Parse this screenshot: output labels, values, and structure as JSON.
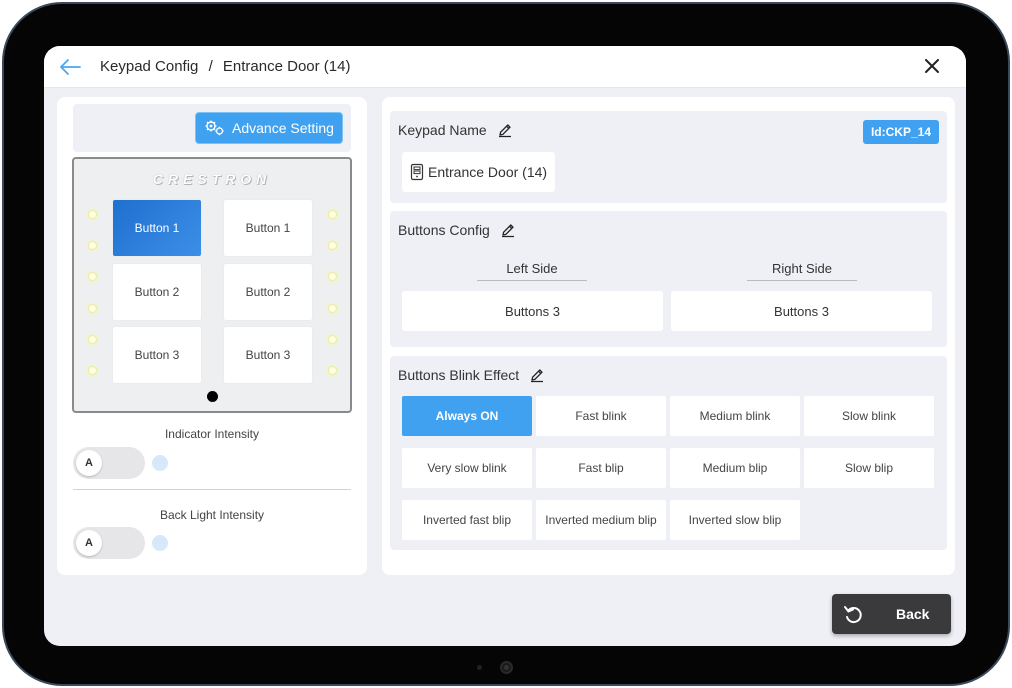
{
  "header": {
    "breadcrumb_parent": "Keypad Config",
    "breadcrumb_sep": "/",
    "breadcrumb_current": "Entrance Door (14)"
  },
  "left": {
    "advance_setting_label": "Advance Setting",
    "brand": "CRESTRON",
    "buttons": [
      {
        "label": "Button  1"
      },
      {
        "label": "Button  1"
      },
      {
        "label": "Button  2"
      },
      {
        "label": "Button  2"
      },
      {
        "label": "Button  3"
      },
      {
        "label": "Button  3"
      }
    ],
    "indicator_intensity_label": "Indicator Intensity",
    "indicator_toggle": "A",
    "backlight_intensity_label": "Back Light Intensity",
    "backlight_toggle": "A"
  },
  "keypad_name": {
    "title": "Keypad Name",
    "id_badge": "Id:CKP_14",
    "value": "Entrance Door (14)"
  },
  "buttons_config": {
    "title": "Buttons Config",
    "left_side_label": "Left Side",
    "left_side_value": "Buttons 3",
    "right_side_label": "Right Side",
    "right_side_value": "Buttons 3"
  },
  "blink_effect": {
    "title": "Buttons Blink Effect",
    "selected": "Always ON",
    "options": [
      "Always ON",
      "Fast blink",
      "Medium blink",
      "Slow blink",
      "Very slow blink",
      "Fast blip",
      "Medium blip",
      "Slow blip",
      "Inverted fast blip",
      "Inverted medium blip",
      "Inverted slow blip"
    ]
  },
  "footer": {
    "back_label": "Back"
  },
  "colors": {
    "accent": "#3fa1ef",
    "active_button": "#2b7ad6",
    "back_button": "#3a3a3c",
    "screen_bg": "#eff0f6"
  }
}
